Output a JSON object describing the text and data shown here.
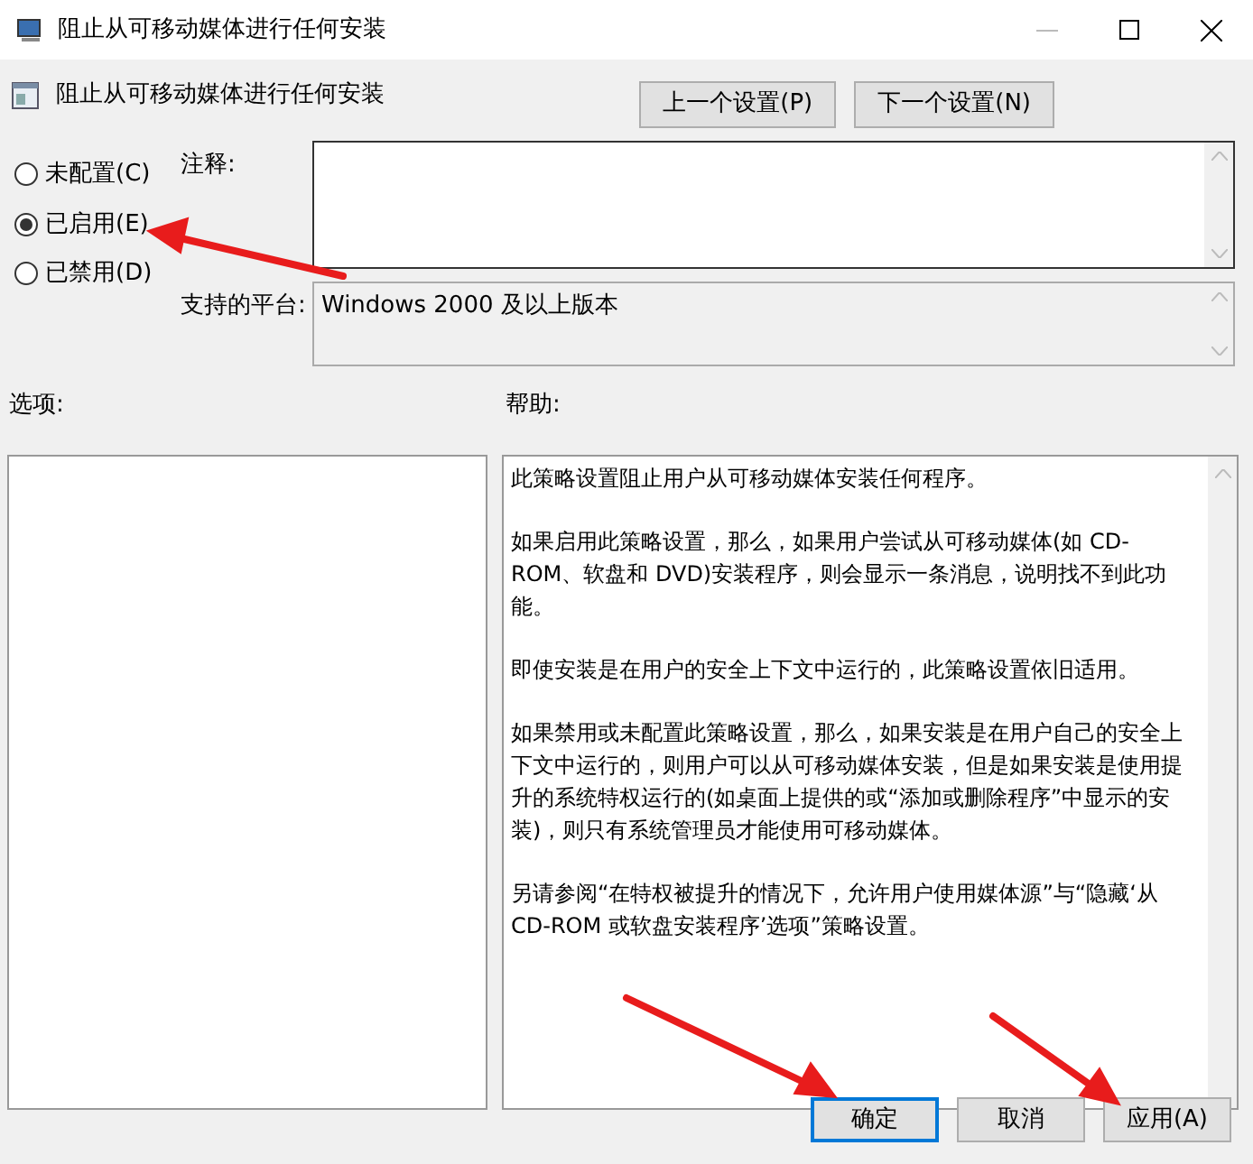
{
  "window": {
    "title": "阻止从可移动媒体进行任何安装"
  },
  "header": {
    "title": "阻止从可移动媒体进行任何安装",
    "buttons": [
      "上一个设置(P)",
      "下一个设置(N)"
    ]
  },
  "state_options": [
    {
      "label": "未配置(C)",
      "selected": false
    },
    {
      "label": "已启用(E)",
      "selected": true
    },
    {
      "label": "已禁用(D)",
      "selected": false
    }
  ],
  "comment": {
    "label": "注释:"
  },
  "platform": {
    "label": "支持的平台:",
    "value": "Windows 2000 及以上版本"
  },
  "options": {
    "label": "选项:"
  },
  "help": {
    "label": "帮助:",
    "paragraphs": [
      "此策略设置阻止用户从可移动媒体安装任何程序。",
      "如果启用此策略设置，那么，如果用户尝试从可移动媒体(如 CD-ROM、软盘和 DVD)安装程序，则会显示一条消息，说明找不到此功能。",
      "即使安装是在用户的安全上下文中运行的，此策略设置依旧适用。",
      "如果禁用或未配置此策略设置，那么，如果安装是在用户自己的安全上下文中运行的，则用户可以从可移动媒体安装，但是如果安装是使用提升的系统特权运行的(如桌面上提供的或“添加或删除程序”中显示的安装)，则只有系统管理员才能使用可移动媒体。",
      "另请参阅“在特权被提升的情况下，允许用户使用媒体源”与“隐藏‘从 CD-ROM 或软盘安装程序’选项”策略设置。"
    ]
  },
  "footer_buttons": [
    {
      "label": "确定",
      "selected": true
    },
    {
      "label": "取消",
      "selected": false
    },
    {
      "label": "应用(A)",
      "selected": false
    }
  ]
}
